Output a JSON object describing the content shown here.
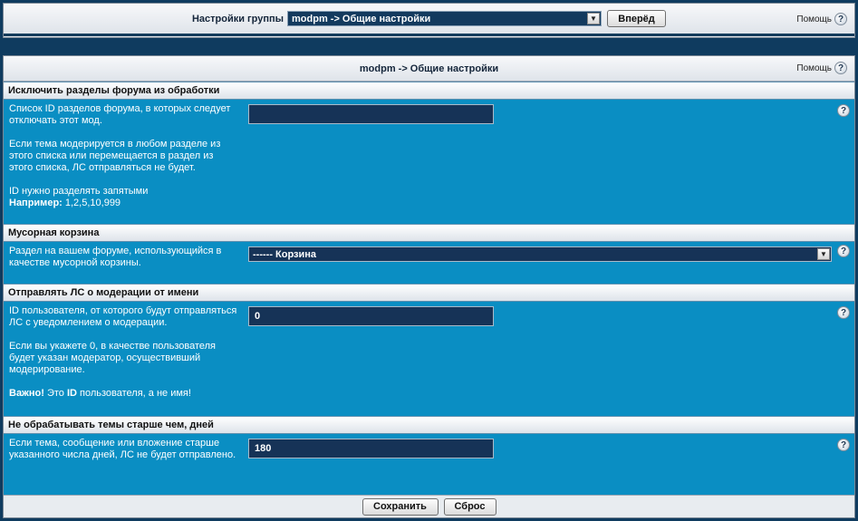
{
  "top": {
    "group_label": "Настройки группы",
    "group_select": "modpm -> Общие настройки",
    "forward_label": "Вперёд",
    "help_label": "Помощь",
    "help_glyph": "?"
  },
  "panel": {
    "title": "modpm -> Общие настройки",
    "help_label": "Помощь",
    "help_glyph": "?"
  },
  "sections": [
    {
      "title": "Исключить разделы форума из обработки",
      "desc": {
        "p1": "Список ID разделов форума, в которых следует отключать этот мод.",
        "p2": "Если тема модерируется в любом разделе из этого списка или перемещается в раздел из этого списка, ЛС отправляться не будет.",
        "p3": "ID нужно разделять запятыми",
        "example_bold": "Например:",
        "example_value": " 1,2,5,10,999"
      },
      "value": ""
    },
    {
      "title": "Мусорная корзина",
      "desc": {
        "p1": "Раздел на вашем форуме, использующийся в качестве мусорной корзины."
      },
      "value": "------ Корзина"
    },
    {
      "title": "Отправлять ЛС о модерации от имени",
      "desc": {
        "p1": "ID пользователя, от которого будут отправляться ЛС с уведомлением о модерации.",
        "p2": "Если вы укажете 0, в качестве пользователя будет указан модератор, осуществивший модерирование.",
        "important_bold": "Важно!",
        "important_mid": " Это ",
        "important_id": "ID",
        "important_end": " пользователя, а не имя!"
      },
      "value": "0"
    },
    {
      "title": "Не обрабатывать темы старше чем, дней",
      "desc": {
        "p1": "Если тема, сообщение или вложение старше указанного числа дней, ЛС не будет отправлено."
      },
      "value": "180"
    }
  ],
  "footer": {
    "save_label": "Сохранить",
    "reset_label": "Сброс"
  },
  "colors": {
    "panel_bg": "#0a8ec3",
    "page_bg": "#0f3b5f",
    "field_bg": "#163357"
  },
  "icons": {
    "dropdown": "chevron-down-icon",
    "help": "help-icon"
  }
}
